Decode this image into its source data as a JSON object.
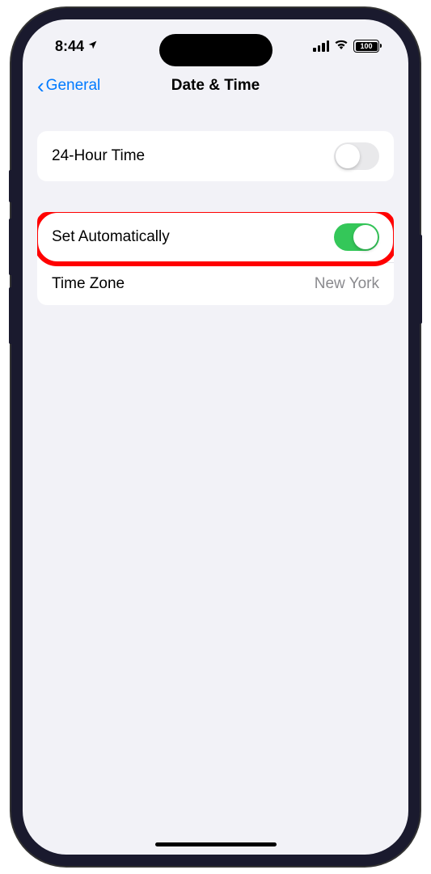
{
  "statusBar": {
    "time": "8:44",
    "batteryLevel": "100"
  },
  "navBar": {
    "backLabel": "General",
    "title": "Date & Time"
  },
  "groups": [
    {
      "rows": [
        {
          "label": "24-Hour Time",
          "toggleOn": false
        }
      ]
    },
    {
      "rows": [
        {
          "label": "Set Automatically",
          "toggleOn": true,
          "highlighted": true
        },
        {
          "label": "Time Zone",
          "value": "New York"
        }
      ]
    }
  ]
}
